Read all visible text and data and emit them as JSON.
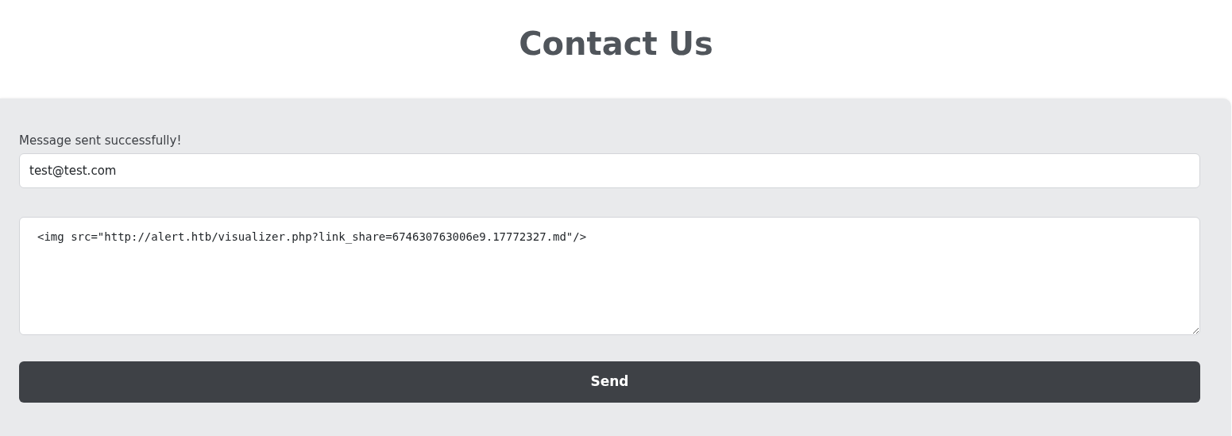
{
  "title": "Contact Us",
  "form": {
    "status_message": "Message sent successfully!",
    "email": {
      "value": "test@test.com"
    },
    "message": {
      "value": "<img src=\"http://alert.htb/visualizer.php?link_share=674630763006e9.17772327.md\"/>"
    },
    "submit": "Send"
  }
}
